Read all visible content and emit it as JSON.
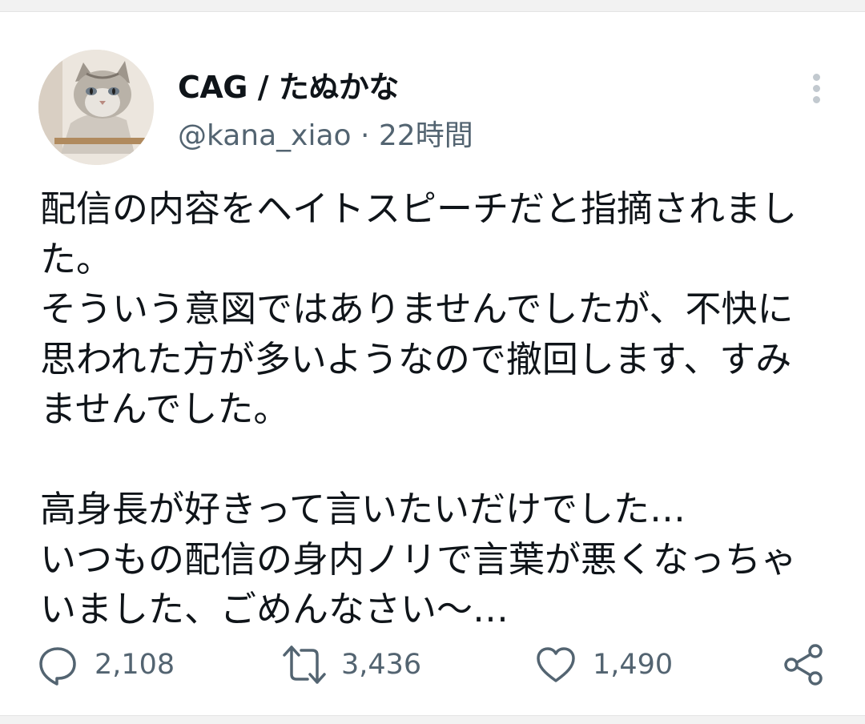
{
  "tweet": {
    "author": {
      "display_name": "CAG / たぬかな",
      "handle": "@kana_xiao",
      "avatar": "cat-photo"
    },
    "separator": "·",
    "time": "22時間",
    "more_icon": "more-vertical-icon",
    "text_lines": [
      "配信の内容をヘイトスピーチだと指摘されまし",
      "た。",
      "そういう意図ではありませんでしたが、不快に",
      "思われた方が多いようなので撤回します、すみ",
      "ませんでした。",
      "",
      "高身長が好きって言いたいだけでした…",
      "いつもの配信の身内ノリで言葉が悪くなっちゃ",
      "いました、ごめんなさい〜…"
    ],
    "actions": {
      "reply": {
        "icon": "reply-icon",
        "count": "2,108"
      },
      "retweet": {
        "icon": "retweet-icon",
        "count": "3,436"
      },
      "like": {
        "icon": "heart-icon",
        "count": "1,490"
      },
      "share": {
        "icon": "share-icon"
      }
    }
  },
  "colors": {
    "text": "#0f1419",
    "secondary": "#536471",
    "icon": "#536471",
    "divider": "#e4e4e4"
  }
}
